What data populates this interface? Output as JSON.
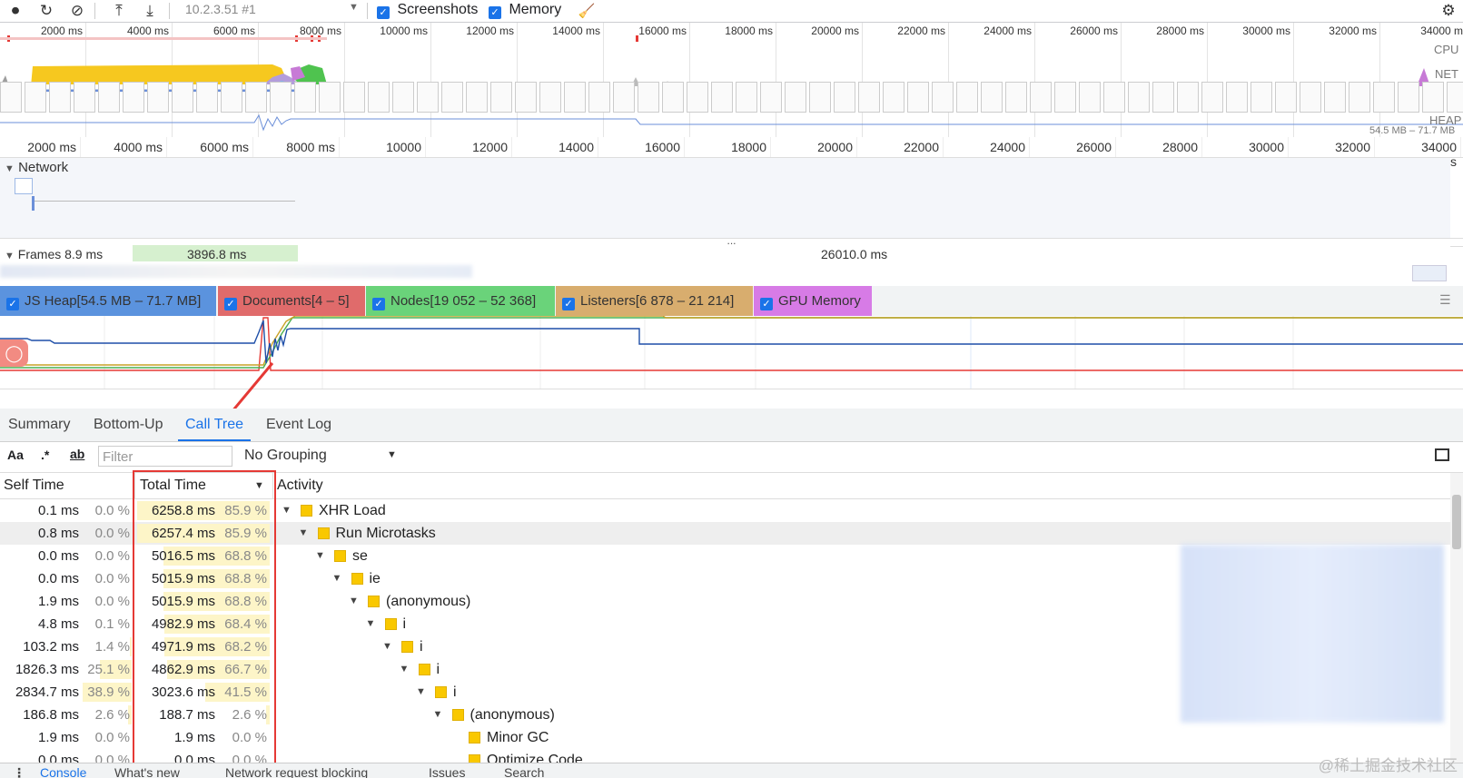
{
  "toolbar": {
    "url": "10.2.3.51 #1",
    "screenshots_label": "Screenshots",
    "memory_label": "Memory"
  },
  "overview": {
    "ticks": [
      "2000 ms",
      "4000 ms",
      "6000 ms",
      "8000 ms",
      "10000 ms",
      "12000 ms",
      "14000 ms",
      "16000 ms",
      "18000 ms",
      "20000 ms",
      "22000 ms",
      "24000 ms",
      "26000 ms",
      "28000 ms",
      "30000 ms",
      "32000 ms",
      "34000 m"
    ],
    "cpu_label": "CPU",
    "net_label": "NET",
    "heap_label": "HEAP",
    "heap_range": "54.5 MB – 71.7 MB"
  },
  "ruler": {
    "ticks": [
      "2000 ms",
      "4000 ms",
      "6000 ms",
      "8000 ms",
      "10000 ms",
      "12000 ms",
      "14000 ms",
      "16000 ms",
      "18000 ms",
      "20000 ms",
      "22000 ms",
      "24000 ms",
      "26000 ms",
      "28000 ms",
      "30000 ms",
      "32000 ms",
      "34000 ms"
    ]
  },
  "tracks": {
    "network_label": "Network",
    "frames_label": "Frames",
    "frames_value": "8.9 ms",
    "frame_mid": "3896.8 ms",
    "frame_long": "26010.0 ms",
    "ellipsis": "..."
  },
  "counters": [
    {
      "label": "JS Heap[54.5 MB – 71.7 MB]",
      "color": "#5b93de"
    },
    {
      "label": "Documents[4 – 5]",
      "color": "#e06b6b"
    },
    {
      "label": "Nodes[19 052 – 52 368]",
      "color": "#6ad37a"
    },
    {
      "label": "Listeners[6 878 – 21 214]",
      "color": "#d8ad6e"
    },
    {
      "label": "GPU Memory",
      "color": "#d77be6"
    }
  ],
  "tabs": {
    "summary": "Summary",
    "bottom_up": "Bottom-Up",
    "call_tree": "Call Tree",
    "event_log": "Event Log"
  },
  "filterbar": {
    "case_label": "Aa",
    "regex_label": ".*",
    "word_label": "ab",
    "filter_placeholder": "Filter",
    "grouping": "No Grouping"
  },
  "table": {
    "col_self": "Self Time",
    "col_total": "Total Time",
    "col_activity": "Activity",
    "rows": [
      {
        "self": "0.1 ms",
        "self_pct": "0.0 %",
        "total": "6258.8 ms",
        "total_pct": "85.9 %",
        "activity": "XHR Load",
        "depth": 0
      },
      {
        "self": "0.8 ms",
        "self_pct": "0.0 %",
        "total": "6257.4 ms",
        "total_pct": "85.9 %",
        "activity": "Run Microtasks",
        "depth": 1
      },
      {
        "self": "0.0 ms",
        "self_pct": "0.0 %",
        "total": "5016.5 ms",
        "total_pct": "68.8 %",
        "activity": "se",
        "depth": 2
      },
      {
        "self": "0.0 ms",
        "self_pct": "0.0 %",
        "total": "5015.9 ms",
        "total_pct": "68.8 %",
        "activity": "ie",
        "depth": 3
      },
      {
        "self": "1.9 ms",
        "self_pct": "0.0 %",
        "total": "5015.9 ms",
        "total_pct": "68.8 %",
        "activity": "(anonymous)",
        "depth": 4
      },
      {
        "self": "4.8 ms",
        "self_pct": "0.1 %",
        "total": "4982.9 ms",
        "total_pct": "68.4 %",
        "activity": "i",
        "depth": 5
      },
      {
        "self": "103.2 ms",
        "self_pct": "1.4 %",
        "total": "4971.9 ms",
        "total_pct": "68.2 %",
        "activity": "i",
        "depth": 6
      },
      {
        "self": "1826.3 ms",
        "self_pct": "25.1 %",
        "total": "4862.9 ms",
        "total_pct": "66.7 %",
        "activity": "i",
        "depth": 7
      },
      {
        "self": "2834.7 ms",
        "self_pct": "38.9 %",
        "total": "3023.6 ms",
        "total_pct": "41.5 %",
        "activity": "i",
        "depth": 8
      },
      {
        "self": "186.8 ms",
        "self_pct": "2.6 %",
        "total": "188.7 ms",
        "total_pct": "2.6 %",
        "activity": "(anonymous)",
        "depth": 9
      },
      {
        "self": "1.9 ms",
        "self_pct": "0.0 %",
        "total": "1.9 ms",
        "total_pct": "0.0 %",
        "activity": "Minor GC",
        "depth": 10
      },
      {
        "self": "0.0 ms",
        "self_pct": "0.0 %",
        "total": "0.0 ms",
        "total_pct": "0.0 %",
        "activity": "Optimize Code",
        "depth": 10
      }
    ]
  },
  "bottom_tabs": [
    "Console",
    "What's new",
    "Network request blocking",
    "Issues",
    "Search"
  ],
  "watermark": "@稀土掘金技术社区"
}
